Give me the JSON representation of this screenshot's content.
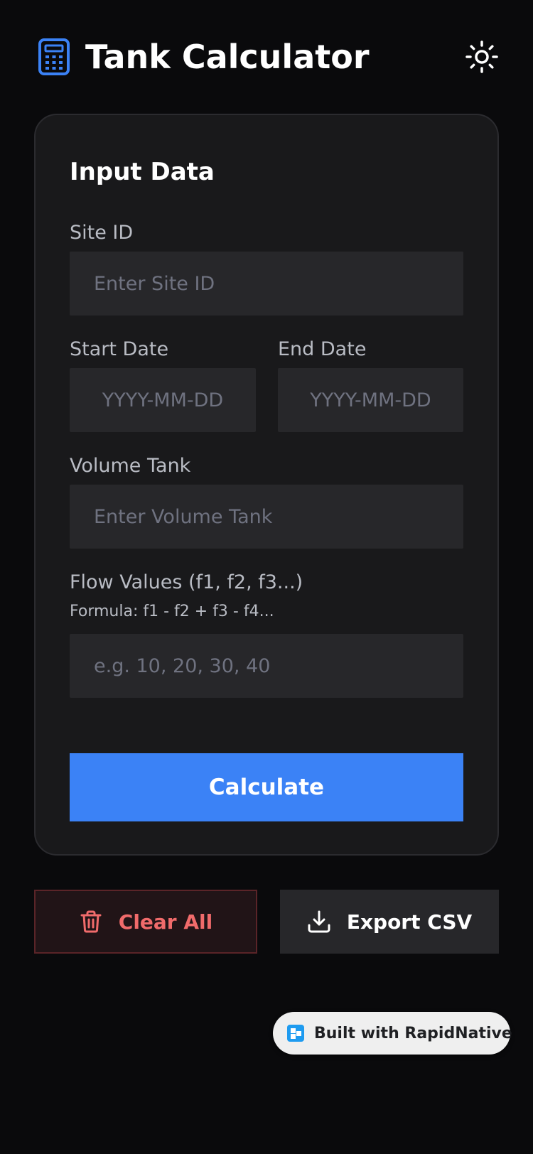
{
  "header": {
    "title": "Tank Calculator",
    "app_icon": "calculator-icon",
    "theme_icon": "sun-icon"
  },
  "card": {
    "title": "Input Data",
    "site_id": {
      "label": "Site ID",
      "placeholder": "Enter Site ID",
      "value": ""
    },
    "start_date": {
      "label": "Start Date",
      "placeholder": "YYYY-MM-DD",
      "value": ""
    },
    "end_date": {
      "label": "End Date",
      "placeholder": "YYYY-MM-DD",
      "value": ""
    },
    "volume_tank": {
      "label": "Volume Tank",
      "placeholder": "Enter Volume Tank",
      "value": ""
    },
    "flow_values": {
      "label": "Flow Values (f1, f2, f3...)",
      "hint": "Formula: f1 - f2 + f3 - f4...",
      "placeholder": "e.g. 10, 20, 30, 40",
      "value": ""
    },
    "calculate_label": "Calculate"
  },
  "actions": {
    "clear_label": "Clear All",
    "clear_icon": "trash-icon",
    "export_label": "Export CSV",
    "export_icon": "download-icon"
  },
  "badge": {
    "text": "Built with RapidNative",
    "icon": "rapidnative-logo-icon"
  },
  "colors": {
    "background": "#0a0a0c",
    "card": "#19191b",
    "input": "#27272a",
    "accent": "#3b82f6",
    "danger": "#f06b6b"
  }
}
